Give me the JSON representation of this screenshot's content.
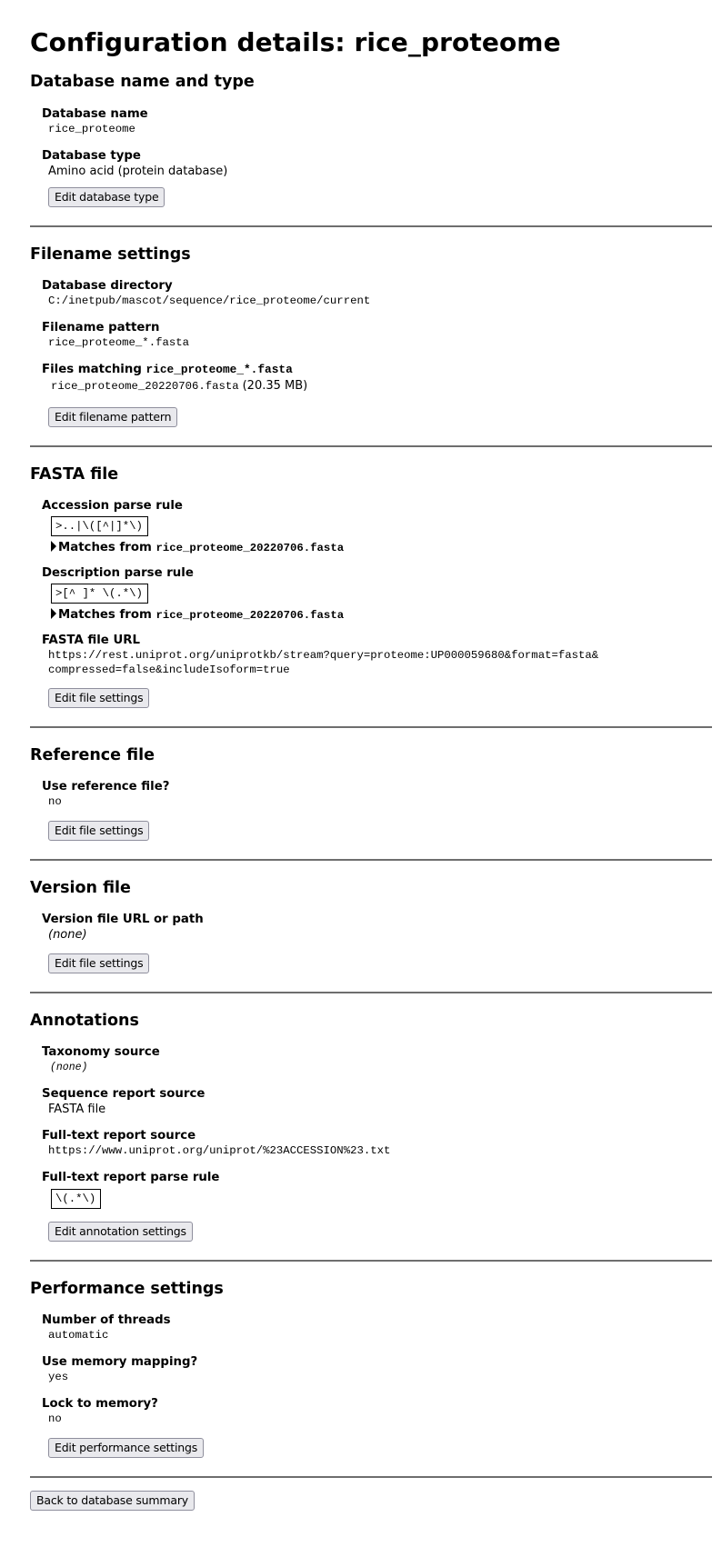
{
  "page": {
    "title": "Configuration details: rice_proteome"
  },
  "sections": {
    "name_type": {
      "heading": "Database name and type",
      "db_name_label": "Database name",
      "db_name_value": "rice_proteome",
      "db_type_label": "Database type",
      "db_type_value": "Amino acid (protein database)",
      "edit_button": "Edit database type"
    },
    "filename": {
      "heading": "Filename settings",
      "dir_label": "Database directory",
      "dir_value": "C:/inetpub/mascot/sequence/rice_proteome/current",
      "pattern_label": "Filename pattern",
      "pattern_value": "rice_proteome_*.fasta",
      "matching_label": "Files matching",
      "matching_pattern": "rice_proteome_*.fasta",
      "files": [
        {
          "name": "rice_proteome_20220706.fasta",
          "size": "(20.35 MB)"
        }
      ],
      "edit_button": "Edit filename pattern"
    },
    "fasta": {
      "heading": "FASTA file",
      "accession_label": "Accession parse rule",
      "accession_rule": ">..|\\([^|]*\\)",
      "accession_matches_label": "Matches from",
      "accession_matches_file": "rice_proteome_20220706.fasta",
      "description_label": "Description parse rule",
      "description_rule": ">[^ ]* \\(.*\\)",
      "description_matches_label": "Matches from",
      "description_matches_file": "rice_proteome_20220706.fasta",
      "url_label": "FASTA file URL",
      "url_line1": "https://rest.uniprot.org/uniprotkb/stream?query=proteome:UP000059680&format=fasta&",
      "url_line2": "compressed=false&includeIsoform=true",
      "edit_button": "Edit file settings"
    },
    "reference": {
      "heading": "Reference file",
      "use_label": "Use reference file?",
      "use_value": "no",
      "edit_button": "Edit file settings"
    },
    "version": {
      "heading": "Version file",
      "url_label": "Version file URL or path",
      "url_value": "(none)",
      "edit_button": "Edit file settings"
    },
    "annotations": {
      "heading": "Annotations",
      "taxonomy_label": "Taxonomy source",
      "taxonomy_value": "(none)",
      "seq_report_label": "Sequence report source",
      "seq_report_value": "FASTA file",
      "fulltext_source_label": "Full-text report source",
      "fulltext_source_value": "https://www.uniprot.org/uniprot/%23ACCESSION%23.txt",
      "fulltext_rule_label": "Full-text report parse rule",
      "fulltext_rule_value": "\\(.*\\)",
      "edit_button": "Edit annotation settings"
    },
    "performance": {
      "heading": "Performance settings",
      "threads_label": "Number of threads",
      "threads_value": "automatic",
      "mmap_label": "Use memory mapping?",
      "mmap_value": "yes",
      "lock_label": "Lock to memory?",
      "lock_value": "no",
      "edit_button": "Edit performance settings"
    }
  },
  "footer": {
    "back_button": "Back to database summary"
  }
}
